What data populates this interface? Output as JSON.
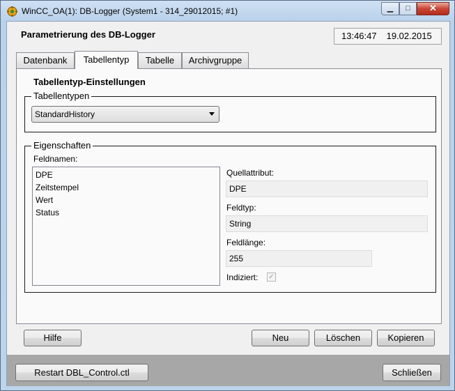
{
  "window": {
    "title": "WinCC_OA(1): DB-Logger (System1 - 314_29012015; #1)",
    "icons": {
      "app": "wincc-app-icon",
      "minimize": "minimize-icon",
      "maximize": "maximize-icon",
      "close": "close-icon"
    },
    "minimize_glyph": "▁",
    "maximize_glyph": "□",
    "close_glyph": "✕"
  },
  "header": {
    "title": "Parametrierung des DB-Logger",
    "time": "13:46:47",
    "date": "19.02.2015"
  },
  "tabs": [
    {
      "label": "Datenbank",
      "active": false
    },
    {
      "label": "Tabellentyp",
      "active": true
    },
    {
      "label": "Tabelle",
      "active": false
    },
    {
      "label": "Archivgruppe",
      "active": false
    }
  ],
  "panel": {
    "heading": "Tabellentyp-Einstellungen",
    "tabellentypen": {
      "legend": "Tabellentypen",
      "selected": "StandardHistory"
    },
    "eigenschaften": {
      "legend": "Eigenschaften",
      "feldnamen_label": "Feldnamen:",
      "feldnamen": [
        "DPE",
        "Zeitstempel",
        "Wert",
        "Status"
      ],
      "quellattribut_label": "Quellattribut:",
      "quellattribut_value": "DPE",
      "feldtyp_label": "Feldtyp:",
      "feldtyp_value": "String",
      "feldlaenge_label": "Feldlänge:",
      "feldlaenge_value": "255",
      "indiziert_label": "Indiziert:",
      "indiziert_checked": true,
      "indiziert_glyph": "✓"
    }
  },
  "buttons": {
    "hilfe": "Hilfe",
    "neu": "Neu",
    "loeschen": "Löschen",
    "kopieren": "Kopieren",
    "restart": "Restart DBL_Control.ctl",
    "schliessen": "Schließen"
  },
  "colors": {
    "titlebar": "#bcd4ec",
    "client_bg": "#f0f0f0",
    "bottom_bar": "#a7a7a7",
    "close_button": "#c94534"
  }
}
